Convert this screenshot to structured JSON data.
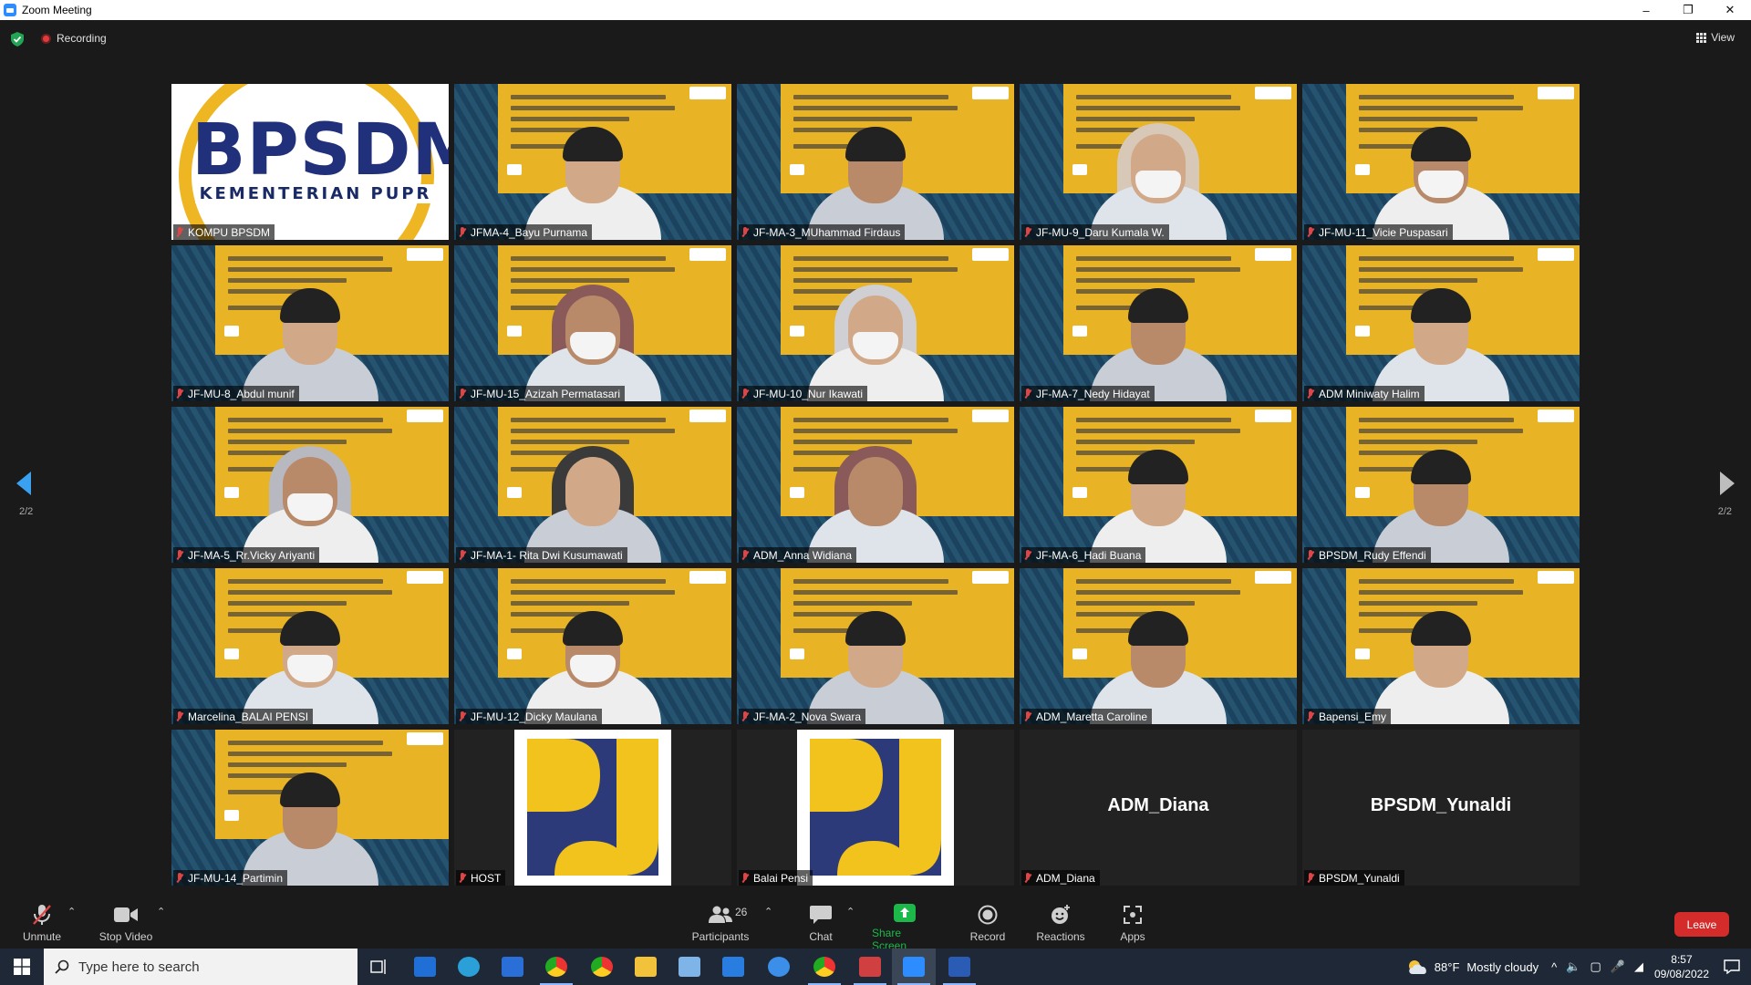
{
  "window": {
    "title": "Zoom Meeting",
    "controls": {
      "minimize": "–",
      "maximize": "❐",
      "close": "✕"
    }
  },
  "topbar": {
    "recording_label": "Recording",
    "view_label": "View"
  },
  "gallery": {
    "tiles": [
      {
        "name": "KOMPU BPSDM",
        "kind": "logo-bpsdm",
        "logo_main": "BPSDM",
        "logo_sub": "KEMENTERIAN PUPR"
      },
      {
        "name": "JFMA-4_Bayu Purnama",
        "kind": "video"
      },
      {
        "name": "JF-MA-3_MUhammad Firdaus",
        "kind": "video"
      },
      {
        "name": "JF-MU-9_Daru Kumala W.",
        "kind": "video"
      },
      {
        "name": "JF-MU-11_Vicie Puspasari",
        "kind": "video"
      },
      {
        "name": "JF-MU-8_Abdul munif",
        "kind": "video"
      },
      {
        "name": "JF-MU-15_Azizah Permatasari",
        "kind": "video"
      },
      {
        "name": "JF-MU-10_Nur Ikawati",
        "kind": "video"
      },
      {
        "name": "JF-MA-7_Nedy Hidayat",
        "kind": "video"
      },
      {
        "name": "ADM Miniwaty Halim",
        "kind": "video"
      },
      {
        "name": "JF-MA-5_Rr.Vicky Ariyanti",
        "kind": "video"
      },
      {
        "name": "JF-MA-1- Rita Dwi Kusumawati",
        "kind": "video"
      },
      {
        "name": "ADM_Anna Widiana",
        "kind": "video"
      },
      {
        "name": "JF-MA-6_Hadi Buana",
        "kind": "video"
      },
      {
        "name": "BPSDM_Rudy Effendi",
        "kind": "video"
      },
      {
        "name": "Marcelina_BALAI PENSI",
        "kind": "video"
      },
      {
        "name": "JF-MU-12_Dicky Maulana",
        "kind": "video"
      },
      {
        "name": "JF-MA-2_Nova Swara",
        "kind": "video"
      },
      {
        "name": "ADM_Maretta Caroline",
        "kind": "video"
      },
      {
        "name": "Bapensi_Emy",
        "kind": "video"
      },
      {
        "name": "JF-MU-14_Partimin",
        "kind": "video"
      },
      {
        "name": "HOST",
        "kind": "avatar-logo"
      },
      {
        "name": "Balai Pensi",
        "kind": "avatar-logo"
      },
      {
        "name": "ADM_Diana",
        "kind": "name-only",
        "big_name": "ADM_Diana"
      },
      {
        "name": "BPSDM_Yunaldi",
        "kind": "name-only",
        "big_name": "BPSDM_Yunaldi"
      }
    ],
    "page_left": "2/2",
    "page_right": "2/2"
  },
  "toolbar": {
    "unmute": "Unmute",
    "stop_video": "Stop Video",
    "participants": "Participants",
    "participants_count": "26",
    "chat": "Chat",
    "share_screen": "Share Screen",
    "record": "Record",
    "reactions": "Reactions",
    "apps": "Apps",
    "leave": "Leave"
  },
  "taskbar": {
    "search_placeholder": "Type here to search",
    "weather_temp": "88°F",
    "weather_desc": "Mostly cloudy",
    "time": "8:57",
    "date": "09/08/2022"
  },
  "colors": {
    "share_green": "#1db84a",
    "leave_red": "#d42b2b",
    "banner_yellow": "#e8b324",
    "pu_blue": "#2c3a7a"
  }
}
